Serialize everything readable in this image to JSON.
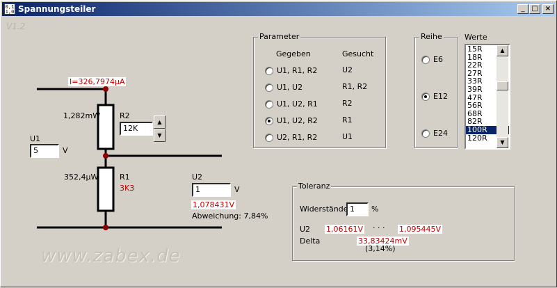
{
  "window": {
    "title": "Spannungsteiler",
    "version": "V1.2",
    "watermark": "www.zabex.de",
    "icon_text": "0,1\n1,0"
  },
  "circuit": {
    "current": "I=326,7974µA",
    "u1_label": "U1",
    "u1_value": "5",
    "u1_unit": "V",
    "r2_label": "R2",
    "r2_power": "1,282mW",
    "r2_value": "12K",
    "r1_label": "R1",
    "r1_power": "352,4µW",
    "r1_value": "3K3",
    "u2_label": "U2",
    "u2_value": "1",
    "u2_unit": "V",
    "u2_actual": "1,078431V",
    "deviation": "Abweichung: 7,84%"
  },
  "parameter": {
    "legend": "Parameter",
    "col_given": "Gegeben",
    "col_sought": "Gesucht",
    "options": [
      {
        "given": "U1, R1, R2",
        "sought": "U2",
        "checked": false
      },
      {
        "given": "U1, U2",
        "sought": "R1, R2",
        "checked": false
      },
      {
        "given": "U1, U2, R1",
        "sought": "R2",
        "checked": false
      },
      {
        "given": "U1, U2, R2",
        "sought": "R1",
        "checked": true
      },
      {
        "given": "U2, R1, R2",
        "sought": "U1",
        "checked": false
      }
    ]
  },
  "reihe": {
    "legend": "Reihe",
    "options": [
      {
        "label": "E6",
        "checked": false
      },
      {
        "label": "E12",
        "checked": true
      },
      {
        "label": "E24",
        "checked": false
      }
    ]
  },
  "werte": {
    "label": "Werte",
    "items": [
      "15R",
      "18R",
      "22R",
      "27R",
      "33R",
      "39R",
      "47R",
      "56R",
      "68R",
      "82R",
      "100R",
      "120R"
    ],
    "selected": "100R"
  },
  "toleranz": {
    "legend": "Toleranz",
    "label": "Widerstände",
    "value": "1",
    "unit": "%",
    "u2_label": "U2",
    "u2_min": "1,06161V",
    "range_sep": "· · ·",
    "u2_max": "1,095445V",
    "delta_label": "Delta",
    "delta_value": "33,83424mV",
    "delta_percent": "(3,14%)"
  },
  "colors": {
    "titlebar_start": "#0a246a",
    "titlebar_end": "#a6caf0",
    "face": "#d4d0c8",
    "value_red": "#c00000",
    "node": "#8b0000"
  }
}
